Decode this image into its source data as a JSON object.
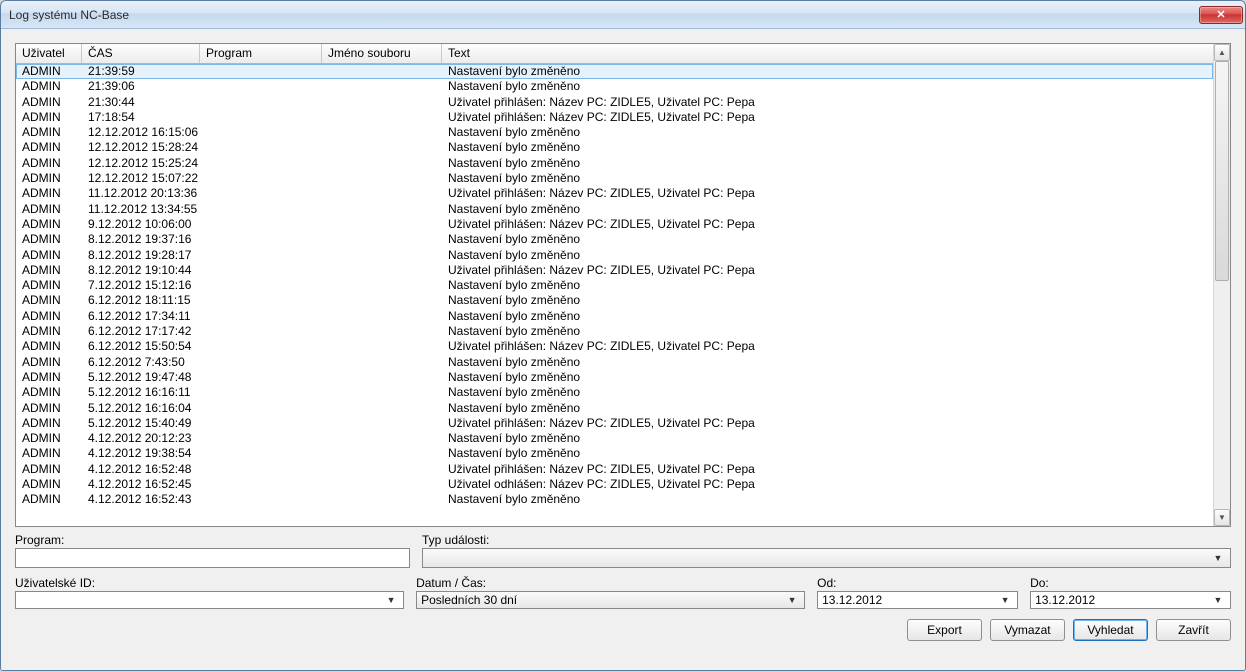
{
  "window": {
    "title": "Log systému NC-Base"
  },
  "columns": {
    "user": "Uživatel",
    "time": "ČAS",
    "program": "Program",
    "filename": "Jméno souboru",
    "text": "Text"
  },
  "rows": [
    {
      "user": "ADMIN",
      "time": "21:39:59",
      "text": "Nastavení bylo změněno"
    },
    {
      "user": "ADMIN",
      "time": "21:39:06",
      "text": "Nastavení bylo změněno"
    },
    {
      "user": "ADMIN",
      "time": "21:30:44",
      "text": "Uživatel přihlášen: Název PC: ZIDLE5, Uživatel PC: Pepa"
    },
    {
      "user": "ADMIN",
      "time": "17:18:54",
      "text": "Uživatel přihlášen: Název PC: ZIDLE5, Uživatel PC: Pepa"
    },
    {
      "user": "ADMIN",
      "time": "12.12.2012 16:15:06",
      "text": "Nastavení bylo změněno"
    },
    {
      "user": "ADMIN",
      "time": "12.12.2012 15:28:24",
      "text": "Nastavení bylo změněno"
    },
    {
      "user": "ADMIN",
      "time": "12.12.2012 15:25:24",
      "text": "Nastavení bylo změněno"
    },
    {
      "user": "ADMIN",
      "time": "12.12.2012 15:07:22",
      "text": "Nastavení bylo změněno"
    },
    {
      "user": "ADMIN",
      "time": "11.12.2012 20:13:36",
      "text": "Uživatel přihlášen: Název PC: ZIDLE5, Uživatel PC: Pepa"
    },
    {
      "user": "ADMIN",
      "time": "11.12.2012 13:34:55",
      "text": "Nastavení bylo změněno"
    },
    {
      "user": "ADMIN",
      "time": "9.12.2012 10:06:00",
      "text": "Uživatel přihlášen: Název PC: ZIDLE5, Uživatel PC: Pepa"
    },
    {
      "user": "ADMIN",
      "time": "8.12.2012 19:37:16",
      "text": "Nastavení bylo změněno"
    },
    {
      "user": "ADMIN",
      "time": "8.12.2012 19:28:17",
      "text": "Nastavení bylo změněno"
    },
    {
      "user": "ADMIN",
      "time": "8.12.2012 19:10:44",
      "text": "Uživatel přihlášen: Název PC: ZIDLE5, Uživatel PC: Pepa"
    },
    {
      "user": "ADMIN",
      "time": "7.12.2012 15:12:16",
      "text": "Nastavení bylo změněno"
    },
    {
      "user": "ADMIN",
      "time": "6.12.2012 18:11:15",
      "text": "Nastavení bylo změněno"
    },
    {
      "user": "ADMIN",
      "time": "6.12.2012 17:34:11",
      "text": "Nastavení bylo změněno"
    },
    {
      "user": "ADMIN",
      "time": "6.12.2012 17:17:42",
      "text": "Nastavení bylo změněno"
    },
    {
      "user": "ADMIN",
      "time": "6.12.2012 15:50:54",
      "text": "Uživatel přihlášen: Název PC: ZIDLE5, Uživatel PC: Pepa"
    },
    {
      "user": "ADMIN",
      "time": "6.12.2012 7:43:50",
      "text": "Nastavení bylo změněno"
    },
    {
      "user": "ADMIN",
      "time": "5.12.2012 19:47:48",
      "text": "Nastavení bylo změněno"
    },
    {
      "user": "ADMIN",
      "time": "5.12.2012 16:16:11",
      "text": "Nastavení bylo změněno"
    },
    {
      "user": "ADMIN",
      "time": "5.12.2012 16:16:04",
      "text": "Nastavení bylo změněno"
    },
    {
      "user": "ADMIN",
      "time": "5.12.2012 15:40:49",
      "text": "Uživatel přihlášen: Název PC: ZIDLE5, Uživatel PC: Pepa"
    },
    {
      "user": "ADMIN",
      "time": "4.12.2012 20:12:23",
      "text": "Nastavení bylo změněno"
    },
    {
      "user": "ADMIN",
      "time": "4.12.2012 19:38:54",
      "text": "Nastavení bylo změněno"
    },
    {
      "user": "ADMIN",
      "time": "4.12.2012 16:52:48",
      "text": "Uživatel přihlášen: Název PC: ZIDLE5, Uživatel PC: Pepa"
    },
    {
      "user": "ADMIN",
      "time": "4.12.2012 16:52:45",
      "text": "Uživatel odhlášen: Název PC: ZIDLE5, Uživatel PC: Pepa"
    },
    {
      "user": "ADMIN",
      "time": "4.12.2012 16:52:43",
      "text": "Nastavení bylo změněno"
    }
  ],
  "filters": {
    "program_label": "Program:",
    "program_value": "",
    "typ_label": "Typ události:",
    "typ_value": "",
    "uid_label": "Uživatelské ID:",
    "uid_value": "",
    "date_label": "Datum / Čas:",
    "date_value": "Posledních 30 dní",
    "od_label": "Od:",
    "od_value": "13.12.2012",
    "do_label": "Do:",
    "do_value": "13.12.2012"
  },
  "buttons": {
    "export": "Export",
    "vymazat": "Vymazat",
    "vyhledat": "Vyhledat",
    "zavrit": "Zavřít"
  }
}
